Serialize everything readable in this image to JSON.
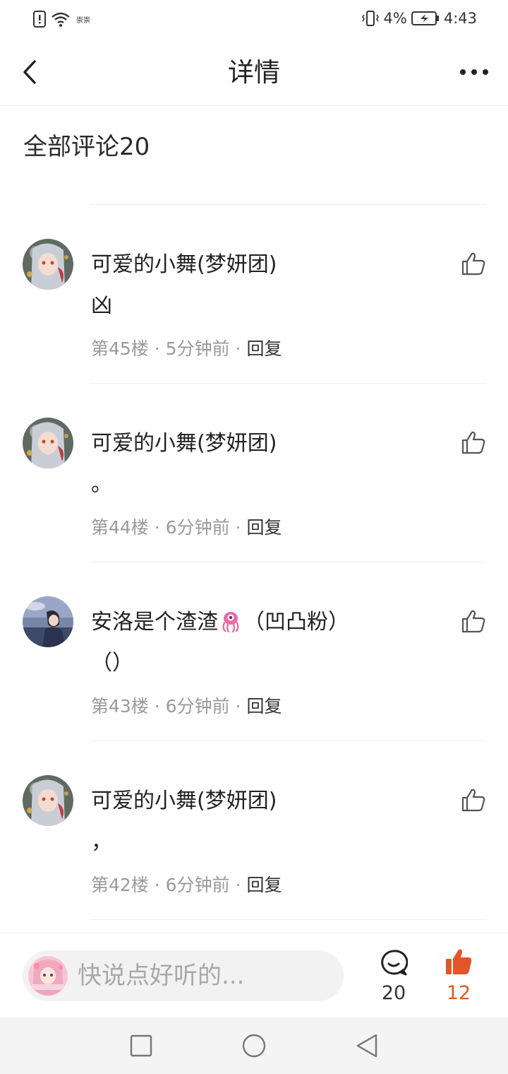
{
  "status_bar": {
    "battery_pct": "4%",
    "time": "4:43",
    "carrier_tiny": "崇崇"
  },
  "header": {
    "title": "详情"
  },
  "comments_section": {
    "title": "全部评论20"
  },
  "comments": [
    {
      "user": "可爱的小舞(梦妍团)",
      "content": "凶",
      "floor": "第45楼",
      "time": "5分钟前",
      "reply": "回复",
      "dot": "·"
    },
    {
      "user": "可爱的小舞(梦妍团)",
      "content": "。",
      "floor": "第44楼",
      "time": "6分钟前",
      "reply": "回复",
      "dot": "·"
    },
    {
      "user": "安洛是个渣渣",
      "user_suffix": "（凹凸粉）",
      "content": "（）",
      "floor": "第43楼",
      "time": "6分钟前",
      "reply": "回复",
      "dot": "·"
    },
    {
      "user": "可爱的小舞(梦妍团)",
      "content": "，",
      "floor": "第42楼",
      "time": "6分钟前",
      "reply": "回复",
      "dot": "·"
    }
  ],
  "bottom_bar": {
    "input_placeholder": "快说点好听的...",
    "comment_count": "20",
    "like_count": "12"
  },
  "colors": {
    "accent": "#e3562a",
    "muted_text": "#9a9a9a",
    "divider": "#ececec"
  }
}
